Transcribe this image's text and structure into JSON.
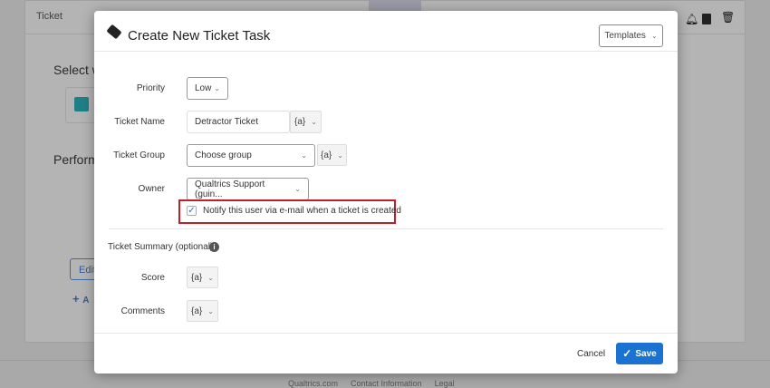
{
  "background": {
    "page_title": "Ticket",
    "select_heading": "Select w",
    "perform_heading": "Perform",
    "edit_label": "Edit",
    "add_label": "A",
    "footer_links": [
      "Qualtrics.com",
      "Contact Information",
      "Legal"
    ]
  },
  "modal": {
    "title": "Create New Ticket Task",
    "templates_label": "Templates",
    "fields": {
      "priority": {
        "label": "Priority",
        "value": "Low"
      },
      "ticket_name": {
        "label": "Ticket Name",
        "value": "Detractor Ticket",
        "piped": "{a}"
      },
      "ticket_group": {
        "label": "Ticket Group",
        "value": "Choose group",
        "piped": "{a}"
      },
      "owner": {
        "label": "Owner",
        "value": "Qualtrics Support (guin..."
      },
      "notify": {
        "label": "Notify this user via e-mail when a ticket is created",
        "checked": true
      }
    },
    "summary": {
      "label": "Ticket Summary (optional)",
      "score_label": "Score",
      "score_piped": "{a}",
      "comments_label": "Comments",
      "comments_piped": "{a}"
    },
    "cancel_label": "Cancel",
    "save_label": "Save"
  },
  "colors": {
    "accent": "#1a73d1",
    "highlight": "#c0202c"
  }
}
